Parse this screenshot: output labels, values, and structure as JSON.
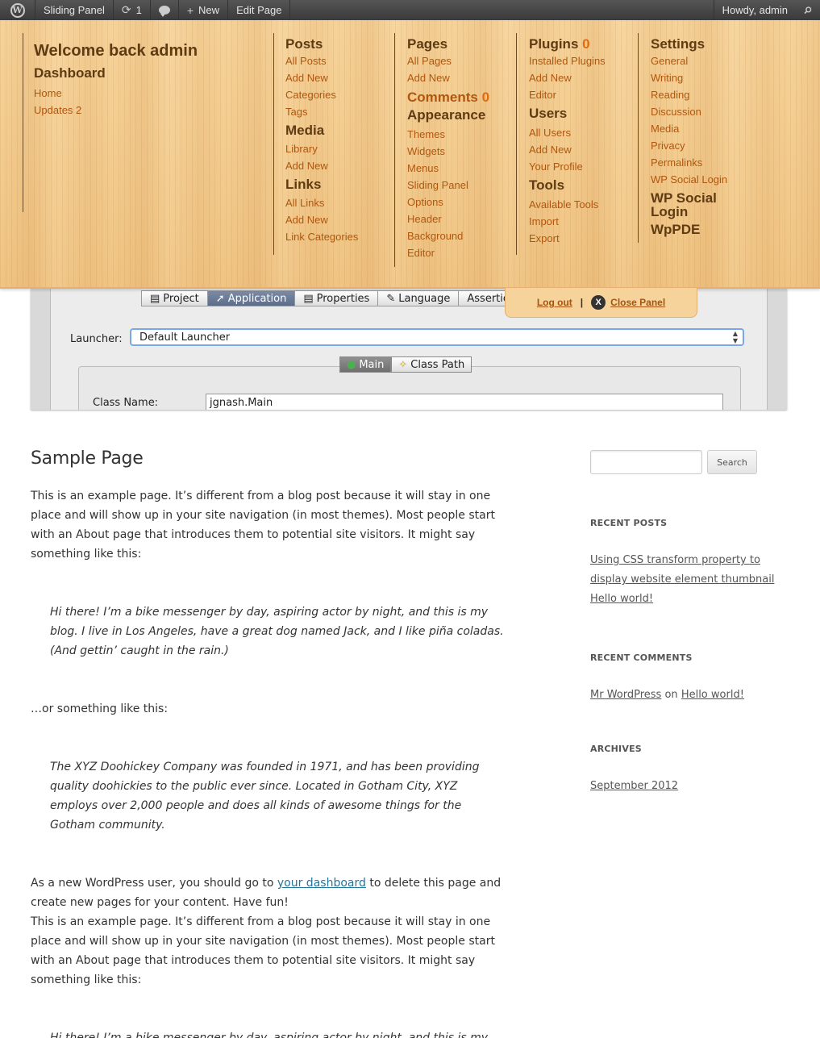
{
  "adminbar": {
    "site_name": "Sliding Panel",
    "updates_count": "1",
    "new_label": "New",
    "edit_label": "Edit Page",
    "howdy": "Howdy, admin"
  },
  "panel": {
    "welcome": "Welcome back admin",
    "dashboard": {
      "heading": "Dashboard",
      "home": "Home",
      "updates": "Updates",
      "updates_count": "2"
    },
    "posts": {
      "heading": "Posts",
      "items": [
        "All Posts",
        "Add New",
        "Categories",
        "Tags"
      ]
    },
    "media": {
      "heading": "Media",
      "items": [
        "Library",
        "Add New"
      ]
    },
    "links": {
      "heading": "Links",
      "items": [
        "All Links",
        "Add New",
        "Link Categories"
      ]
    },
    "pages": {
      "heading": "Pages",
      "items": [
        "All Pages",
        "Add New"
      ]
    },
    "comments": {
      "heading": "Comments",
      "count": "0"
    },
    "appearance": {
      "heading": "Appearance",
      "items": [
        "Themes",
        "Widgets",
        "Menus",
        "Sliding Panel",
        "Options",
        "Header",
        "Background",
        "Editor"
      ]
    },
    "plugins": {
      "heading": "Plugins",
      "count": "0",
      "items": [
        "Installed Plugins",
        "Add New",
        "Editor"
      ]
    },
    "users": {
      "heading": "Users",
      "items": [
        "All Users",
        "Add New",
        "Your Profile"
      ]
    },
    "tools": {
      "heading": "Tools",
      "items": [
        "Available Tools",
        "Import",
        "Export"
      ]
    },
    "settings": {
      "heading": "Settings",
      "items": [
        "General",
        "Writing",
        "Reading",
        "Discussion",
        "Media",
        "Privacy",
        "Permalinks",
        "WP Social Login"
      ]
    },
    "wp_social_login": "WP Social Login",
    "wppde": "WpPDE",
    "logout": "Log out",
    "separator": "|",
    "close_panel": "Close Panel"
  },
  "header_image": {
    "tabs": [
      "Project",
      "Application",
      "Properties",
      "Language",
      "Assertions"
    ],
    "launcher_label": "Launcher:",
    "launcher_value": "Default Launcher",
    "subtabs": [
      "Main",
      "Class Path"
    ],
    "class_name_label": "Class Name:",
    "class_name_value": "jgnash.Main"
  },
  "content": {
    "title": "Sample Page",
    "p1": "This is an example page. It’s different from a blog post because it will stay in one place and will show up in your site navigation (in most themes). Most people start with an About page that introduces them to potential site visitors. It might say something like this:",
    "quote1": "Hi there! I’m a bike messenger by day, aspiring actor by night, and this is my blog. I live in Los Angeles, have a great dog named Jack, and I like piña coladas. (And gettin’ caught in the rain.)",
    "p2": "…or something like this:",
    "quote2": "The XYZ Doohickey Company was founded in 1971, and has been providing quality doohickies to the public ever since. Located in Gotham City, XYZ employs over 2,000 people and does all kinds of awesome things for the Gotham community.",
    "p3_before": "As a new WordPress user, you should go to ",
    "p3_link": "your dashboard",
    "p3_after": " to delete this page and create new pages for your content. Have fun!",
    "p4": "This is an example page. It’s different from a blog post because it will stay in one place and will show up in your site navigation (in most themes). Most people start with an About page that introduces them to potential site visitors. It might say something like this:",
    "quote3": "Hi there! I’m a bike messenger by day, aspiring actor by night, and this is my blog. I live in Los Angeles, have a great dog named Jack, and I like piña coladas. (And gettin’ caught in the rain.)"
  },
  "sidebar": {
    "search_button": "Search",
    "recent_posts_title": "RECENT POSTS",
    "recent_posts": [
      "Using CSS transform property to display website element thumbnail",
      "Hello world!"
    ],
    "recent_comments_title": "RECENT COMMENTS",
    "comment_author": "Mr WordPress",
    "comment_on": "on",
    "comment_post": "Hello world!",
    "archives_title": "ARCHIVES",
    "archives": [
      "September 2012"
    ]
  }
}
